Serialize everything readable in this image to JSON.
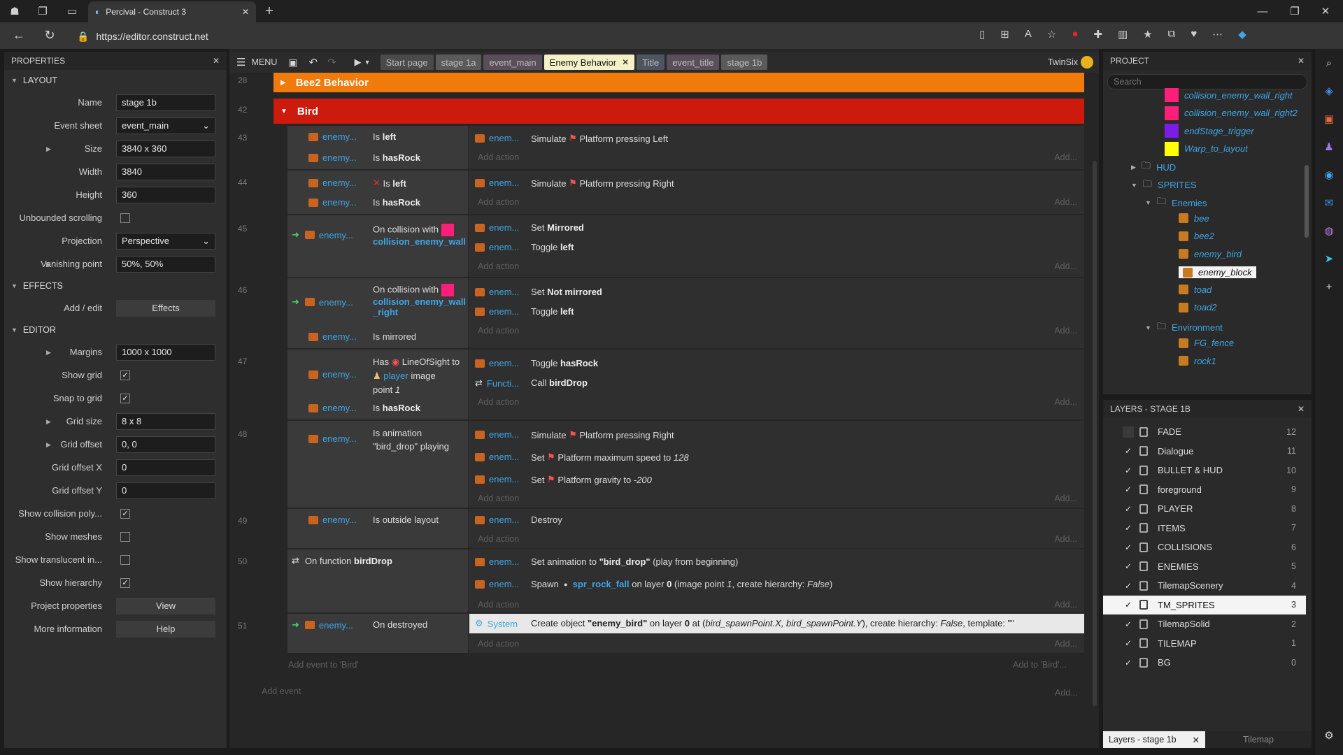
{
  "browser": {
    "tab_title": "Percival - Construct 3",
    "url": "https://editor.construct.net",
    "icon_names": [
      "shield-icon",
      "workspaces-icon",
      "tabs-icon",
      "new-tab-icon"
    ],
    "window_controls": [
      "minimize",
      "maximize",
      "close"
    ]
  },
  "properties": {
    "title": "PROPERTIES",
    "sections": {
      "layout": "LAYOUT",
      "effects": "EFFECTS",
      "editor": "EDITOR"
    },
    "layout_rows": [
      {
        "label": "Name",
        "value": "stage 1b",
        "type": "text"
      },
      {
        "label": "Event sheet",
        "value": "event_main",
        "type": "select"
      },
      {
        "label": "Size",
        "value": "3840 x 360",
        "type": "text",
        "expand": true
      },
      {
        "label": "Width",
        "value": "3840",
        "type": "text"
      },
      {
        "label": "Height",
        "value": "360",
        "type": "text"
      },
      {
        "label": "Unbounded scrolling",
        "value": "",
        "type": "check",
        "checked": false
      },
      {
        "label": "Projection",
        "value": "Perspective",
        "type": "select"
      },
      {
        "label": "Vanishing point",
        "value": "50%, 50%",
        "type": "text",
        "expand": true
      }
    ],
    "effects_rows": [
      {
        "label": "Add / edit",
        "value": "Effects",
        "type": "button"
      }
    ],
    "editor_rows": [
      {
        "label": "Margins",
        "value": "1000 x 1000",
        "type": "text",
        "expand": true
      },
      {
        "label": "Show grid",
        "value": "",
        "type": "check",
        "checked": true
      },
      {
        "label": "Snap to grid",
        "value": "",
        "type": "check",
        "checked": true
      },
      {
        "label": "Grid size",
        "value": "8 x 8",
        "type": "text",
        "expand": true
      },
      {
        "label": "Grid offset",
        "value": "0, 0",
        "type": "text",
        "expand": true
      },
      {
        "label": "Grid offset X",
        "value": "0",
        "type": "text"
      },
      {
        "label": "Grid offset Y",
        "value": "0",
        "type": "text"
      },
      {
        "label": "Show collision poly...",
        "value": "",
        "type": "check",
        "checked": true
      },
      {
        "label": "Show meshes",
        "value": "",
        "type": "check",
        "checked": false
      },
      {
        "label": "Show translucent in...",
        "value": "",
        "type": "check",
        "checked": false
      },
      {
        "label": "Show hierarchy",
        "value": "",
        "type": "check",
        "checked": true
      },
      {
        "label": "Project properties",
        "value": "View",
        "type": "button"
      },
      {
        "label": "More information",
        "value": "Help",
        "type": "button"
      }
    ]
  },
  "toolbar": {
    "menu": "MENU",
    "user": "TwinSix",
    "tabs": [
      {
        "label": "Start page",
        "bg": "#4a4a4a",
        "fg": "#bbbbbb"
      },
      {
        "label": "stage 1a",
        "bg": "#5a5a5a",
        "fg": "#bbbbbb"
      },
      {
        "label": "event_main",
        "bg": "#5a4e5a",
        "fg": "#bbbbbb"
      },
      {
        "label": "Enemy Behavior",
        "bg": "#f4f1c8",
        "fg": "#111111",
        "active": true
      },
      {
        "label": "Title",
        "bg": "#4e5560",
        "fg": "#bbbbbb"
      },
      {
        "label": "event_title",
        "bg": "#5a4e5a",
        "fg": "#bbbbbb"
      },
      {
        "label": "stage 1b",
        "bg": "#5a5a5a",
        "fg": "#bbbbbb"
      }
    ]
  },
  "events": {
    "group_bee2": {
      "num": "28",
      "label": "Bee2 Behavior",
      "color": "#f07a0a"
    },
    "group_bird": {
      "num": "42",
      "label": "Bird",
      "color": "#cc1a0c"
    },
    "add_action": "Add action",
    "add_short": "Add...",
    "add_event_to": "Add event to 'Bird'",
    "add_to_bird": "Add to 'Bird'...",
    "add_event": "Add event",
    "e43": {
      "num": "43",
      "obj": "enemy...",
      "c1": "Is",
      "c1b": "left",
      "c2": "Is",
      "c2b": "hasRock",
      "aobj": "enem...",
      "a1": "Simulate",
      "a1b": "Platform pressing Left"
    },
    "e44": {
      "num": "44",
      "obj": "enemy...",
      "c1": "Is",
      "c1b": "left",
      "c2": "Is",
      "c2b": "hasRock",
      "aobj": "enem...",
      "a1": "Simulate",
      "a1b": "Platform pressing Right"
    },
    "e45": {
      "num": "45",
      "obj": "enemy...",
      "c1": "On collision with",
      "c1b": "collision_enemy_wall",
      "aobj": "enem...",
      "a1": "Set",
      "a1b": "Mirrored",
      "a2": "Toggle",
      "a2b": "left"
    },
    "e46": {
      "num": "46",
      "obj": "enemy...",
      "c1": "On collision with",
      "c1b": "collision_enemy_wall",
      "c1c": "_right",
      "c2": "Is mirrored",
      "aobj": "enem...",
      "a1": "Set",
      "a1b": "Not mirrored",
      "a2": "Toggle",
      "a2b": "left"
    },
    "e47": {
      "num": "47",
      "obj": "enemy...",
      "c1": "Has",
      "c1b": "LineOfSight to",
      "c1c": "player",
      "c1d": "image",
      "c1e": "point",
      "c1f": "1",
      "c2": "Is",
      "c2b": "hasRock",
      "aobj": "enem...",
      "a1": "Toggle",
      "a1b": "hasRock",
      "fobj": "Functi...",
      "a2": "Call",
      "a2b": "birdDrop"
    },
    "e48": {
      "num": "48",
      "obj": "enemy...",
      "c1": "Is animation",
      "c1b": "\"bird_drop\" playing",
      "aobj": "enem...",
      "a1": "Simulate",
      "a1b": "Platform pressing Right",
      "a2": "Set",
      "a2b": "Platform maximum speed to",
      "a2c": "128",
      "a3": "Set",
      "a3b": "Platform gravity to",
      "a3c": "-200"
    },
    "e49": {
      "num": "49",
      "obj": "enemy...",
      "c1": "Is outside layout",
      "aobj": "enem...",
      "a1": "Destroy"
    },
    "e50": {
      "num": "50",
      "c1": "On function",
      "c1b": "birdDrop",
      "aobj": "enem...",
      "a1": "Set animation to",
      "a1b": "\"bird_drop\"",
      "a1c": "(play from beginning)",
      "a2": "Spawn",
      "a2b": "spr_rock_fall",
      "a2c": "on layer",
      "a2d": "0",
      "a2e": "(image point",
      "a2f": "1",
      "a2g": ", create hierarchy:",
      "a2h": "False",
      ")": ")"
    },
    "e51": {
      "num": "51",
      "obj": "enemy...",
      "c1": "On destroyed",
      "aobj": "System",
      "a1": "Create object",
      "a1b": "\"enemy_bird\"",
      "a1c": "on layer",
      "a1d": "0",
      "a1e": "at (",
      "a1f": "bird_spawnPoint.X, bird_spawnPoint.Y",
      "a1g": "), create hierarchy:",
      "a1h": "False",
      "a1i": ", template: \"\""
    }
  },
  "project": {
    "title": "PROJECT",
    "search_placeholder": "Search",
    "items": [
      {
        "label": "collision_enemy_wall_right",
        "kind": "swatch",
        "color": "#ff1e78",
        "indent": 0
      },
      {
        "label": "collision_enemy_wall_right2",
        "kind": "swatch",
        "color": "#ff1e78",
        "indent": 0
      },
      {
        "label": "endStage_trigger",
        "kind": "swatch",
        "color": "#7a1ee6",
        "indent": 0
      },
      {
        "label": "Warp_to_layout",
        "kind": "swatch",
        "color": "#ffff00",
        "indent": 0
      },
      {
        "label": "HUD",
        "kind": "folder",
        "indent": -2
      },
      {
        "label": "SPRITES",
        "kind": "folder",
        "indent": -2,
        "open": true
      },
      {
        "label": "Enemies",
        "kind": "folder",
        "indent": -1,
        "open": true
      },
      {
        "label": "bee",
        "kind": "sprite",
        "indent": 1
      },
      {
        "label": "bee2",
        "kind": "sprite",
        "indent": 1
      },
      {
        "label": "enemy_bird",
        "kind": "sprite",
        "indent": 1
      },
      {
        "label": "enemy_block",
        "kind": "sprite",
        "indent": 1,
        "selected": true
      },
      {
        "label": "toad",
        "kind": "sprite",
        "indent": 1
      },
      {
        "label": "toad2",
        "kind": "sprite",
        "indent": 1
      },
      {
        "label": "Environment",
        "kind": "folder",
        "indent": -1,
        "open": true
      },
      {
        "label": "FG_fence",
        "kind": "sprite",
        "indent": 1
      },
      {
        "label": "rock1",
        "kind": "sprite",
        "indent": 1
      }
    ]
  },
  "layers": {
    "title": "LAYERS - STAGE 1B",
    "bottom_tab": "Layers - stage 1b",
    "bottom_tab2": "Tilemap",
    "items": [
      {
        "name": "FADE",
        "num": "12",
        "checked": false
      },
      {
        "name": "Dialogue",
        "num": "11",
        "checked": true
      },
      {
        "name": "BULLET & HUD",
        "num": "10",
        "checked": true
      },
      {
        "name": "foreground",
        "num": "9",
        "checked": true
      },
      {
        "name": "PLAYER",
        "num": "8",
        "checked": true
      },
      {
        "name": "ITEMS",
        "num": "7",
        "checked": true
      },
      {
        "name": "COLLISIONS",
        "num": "6",
        "checked": true
      },
      {
        "name": "ENEMIES",
        "num": "5",
        "checked": true
      },
      {
        "name": "TilemapScenery",
        "num": "4",
        "checked": true
      },
      {
        "name": "TM_SPRITES",
        "num": "3",
        "checked": true,
        "selected": true
      },
      {
        "name": "TilemapSolid",
        "num": "2",
        "checked": true
      },
      {
        "name": "TILEMAP",
        "num": "1",
        "checked": true
      },
      {
        "name": "BG",
        "num": "0",
        "checked": true
      }
    ]
  }
}
